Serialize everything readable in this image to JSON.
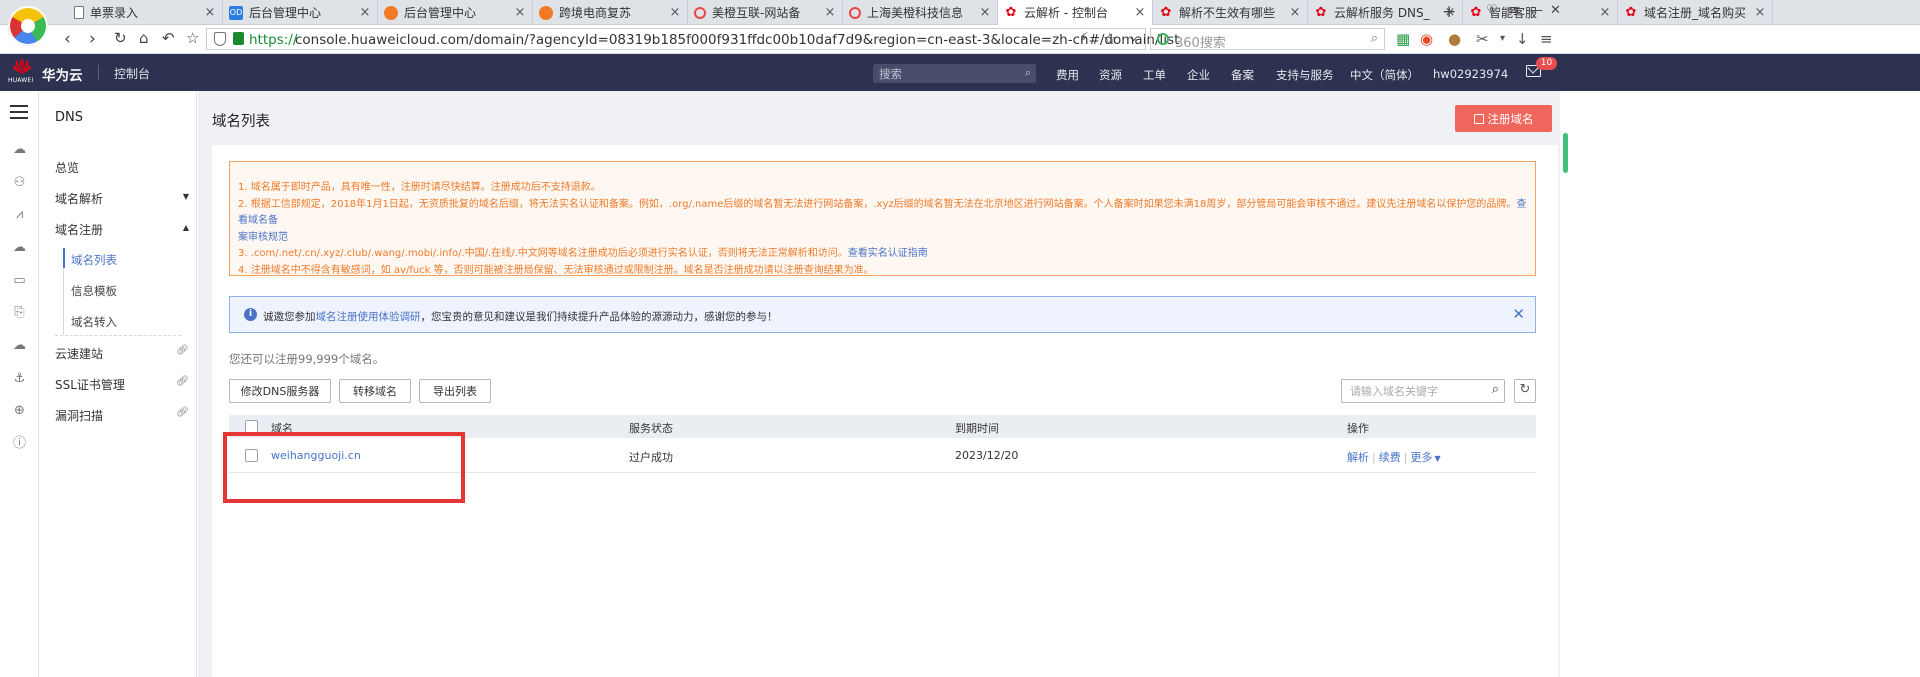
{
  "browser": {
    "tabs": [
      {
        "label": "单票录入",
        "icon": "doc-icon",
        "active": false
      },
      {
        "label": "后台管理中心",
        "icon": "app-icon",
        "active": false
      },
      {
        "label": "后台管理中心",
        "icon": "orange-icon",
        "active": false
      },
      {
        "label": "跨境电商复苏",
        "icon": "orange-icon",
        "active": false
      },
      {
        "label": "美橙互联-网站备",
        "icon": "apple-icon",
        "active": false
      },
      {
        "label": "上海美橙科技信息",
        "icon": "apple-icon",
        "active": false
      },
      {
        "label": "云解析 - 控制台",
        "icon": "huawei-icon",
        "active": true
      },
      {
        "label": "解析不生效有哪些",
        "icon": "huawei-icon",
        "active": false
      },
      {
        "label": "云解析服务 DNS_",
        "icon": "huawei-icon",
        "active": false
      },
      {
        "label": "智能客服",
        "icon": "huawei-icon",
        "active": false
      },
      {
        "label": "域名注册_域名购买",
        "icon": "huawei-icon",
        "active": false
      }
    ],
    "url_scheme": "https://",
    "url_rest": "console.huaweicloud.com/domain/?agencyId=08319b185f000f931ffdc00b10daf7d9&region=cn-east-3&locale=zh-cn#/domain/list",
    "search_placeholder": "360搜索"
  },
  "header": {
    "brand": "华为云",
    "logo_text": "HUAWEI",
    "console_label": "控制台",
    "search_placeholder": "搜索",
    "nav": [
      "费用",
      "资源",
      "工单",
      "企业",
      "备案",
      "支持与服务",
      "中文（简体）",
      "hw02923974"
    ],
    "mail_badge": "10"
  },
  "sidebar": {
    "title": "DNS",
    "items": [
      {
        "label": "总览"
      },
      {
        "label": "域名解析"
      },
      {
        "label": "域名注册"
      }
    ],
    "sub_items": [
      {
        "label": "域名列表"
      },
      {
        "label": "信息模板"
      },
      {
        "label": "域名转入"
      }
    ],
    "link_items": [
      {
        "label": "云速建站"
      },
      {
        "label": "SSL证书管理"
      },
      {
        "label": "漏洞扫描"
      }
    ]
  },
  "main": {
    "title": "域名列表",
    "register_button": "注册域名",
    "notice": {
      "line1": "1. 域名属于即时产品，具有唯一性，注册时请尽快结算。注册成功后不支持退款。",
      "line2a": "2. 根据工信部规定，2018年1月1日起，无资质批复的域名后缀，将无法实名认证和备案。例如，.org/.name后缀的域名暂无法进行网站备案，.xyz后缀的域名暂无法在北京地区进行网站备案。个人备案时如果您未满18周岁，部分管局可能会审核不通过。建议先注册域名以保护您的品牌。",
      "line2_link1": "查看域名备",
      "line2_link2": "案审核规范",
      "line3a": "3. .com/.net/.cn/.xyz/.club/.wang/.mobi/.info/.中国/.在线/.中文网等域名注册成功后必须进行实名认证，否则将无法正常解析和访问。",
      "line3_link": "查看实名认证指南",
      "line4": "4. 注册域名中不得含有敏感词，如 av/fuck 等，否则可能被注册局保留、无法审核通过或限制注册。域名是否注册成功请以注册查询结果为准。"
    },
    "survey": {
      "prefix": "诚邀您参加",
      "link": "域名注册使用体验调研",
      "suffix": "，您宝贵的意见和建议是我们持续提升产品体验的源源动力，感谢您的参与！"
    },
    "quota_text": "您还可以注册99,999个域名。",
    "toolbar": {
      "modify_dns": "修改DNS服务器",
      "transfer": "转移域名",
      "export": "导出列表",
      "search_placeholder": "请输入域名关键字"
    },
    "table": {
      "headers": [
        "域名",
        "服务状态",
        "到期时间",
        "操作"
      ],
      "rows": [
        {
          "domain": "weihangguoji.cn",
          "status": "过户成功",
          "expiry": "2023/12/20",
          "ops": [
            "解析",
            "续费",
            "更多"
          ]
        }
      ]
    }
  },
  "colors": {
    "header_bg": "#2c3250",
    "accent_blue": "#4a73c8",
    "register_red": "#f0665d",
    "notice_orange": "#ee7a2a",
    "highlight_red": "#e53535"
  }
}
